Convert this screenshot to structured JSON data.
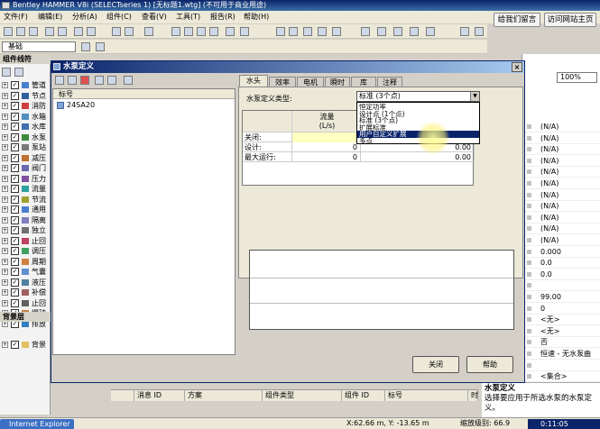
{
  "app": {
    "title": "Bentley HAMMER V8i (SELECTseries 1) [无标题1.wtg] (不可用于商业用途)",
    "web_buttons": [
      "给我们留言",
      "访问网站主页"
    ]
  },
  "menu": [
    "文件(F)",
    "编辑(E)",
    "分析(A)",
    "组件(C)",
    "查看(V)",
    "工具(T)",
    "报告(R)",
    "帮助(H)"
  ],
  "toolbar": {
    "scenario": "基础",
    "zoom": "100%"
  },
  "left_panel": {
    "title": "组件线符",
    "items": [
      "管道",
      "节点",
      "消防",
      "水箱",
      "水库",
      "水泵",
      "泵站",
      "减压",
      "阀门",
      "压力",
      "流量",
      "节流",
      "通用",
      "隔离",
      "独立",
      "止回",
      "调压",
      "周期",
      "气囊",
      "液压",
      "补偿",
      "止回",
      "爆破",
      "排放"
    ],
    "bg_title": "背景层",
    "bg_item": "背景"
  },
  "dialog": {
    "title": "水泵定义",
    "close": "×",
    "list_header": "标号",
    "list_items": [
      "24SA20"
    ],
    "tabs": [
      "水头",
      "效率",
      "电机",
      "瞬时",
      "库",
      "注释"
    ],
    "pump_type_label": "水泵定义类型:",
    "pump_type_value": "标准 (3个点)",
    "pump_type_options": [
      "恒定功率",
      "设计点 (1个点)",
      "标准 (3个点)",
      "扩展标准",
      "用户自定义扩展",
      "多点"
    ],
    "selected_option": 4,
    "grid": {
      "col_flow": "流量",
      "col_flow_unit": "(L/s)",
      "rows": [
        {
          "label": "关闭:",
          "flow": "",
          "head": ""
        },
        {
          "label": "设计:",
          "flow": "0",
          "head": "0.00"
        },
        {
          "label": "最大运行:",
          "flow": "0",
          "head": "0.00"
        }
      ]
    },
    "close_button": "关闭",
    "help_button": "帮助"
  },
  "right_panel": {
    "zoom": "100%",
    "rows": [
      "(N/A)",
      "(N/A)",
      "(N/A)",
      "(N/A)",
      "(N/A)",
      "(N/A)",
      "(N/A)",
      "(N/A)",
      "(N/A)",
      "(N/A)",
      "(N/A)",
      "0.000",
      "0.0",
      "0.0",
      "",
      "99.00",
      "0",
      "<无>",
      "<无>",
      "否",
      "恒速 - 无水泵曲",
      "",
      "<集合>"
    ],
    "help_title": "水泵定义",
    "help_text": "选择要应用于所选水泵的水泵定义。"
  },
  "bottom_table": {
    "headers": [
      "消息 ID",
      "方案",
      "组件类型",
      "组件 ID",
      "标号",
      "时"
    ]
  },
  "status": {
    "taskbar": "Internet Explorer",
    "coords": "X:62.66 m, Y: -13.65 m",
    "zoom_level": "缩放级别: 66.9",
    "clock": "0:11:05"
  }
}
